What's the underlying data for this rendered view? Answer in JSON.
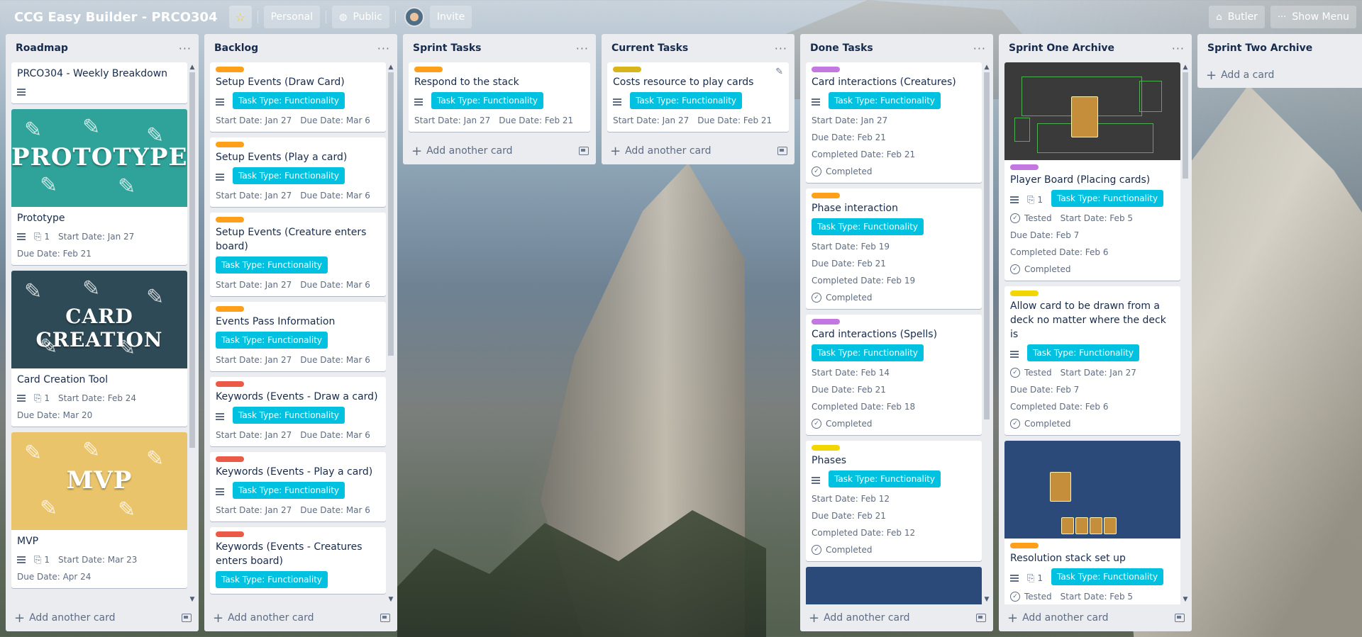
{
  "header": {
    "board_title": "CCG Easy Builder - PRCO304",
    "personal_label": "Personal",
    "public_label": "Public",
    "invite_label": "Invite",
    "butler_label": "Butler",
    "show_menu_label": "Show Menu"
  },
  "common": {
    "add_another_card": "Add another card",
    "add_a_card": "Add a card",
    "task_type": "Task Type: Functionality",
    "completed": "Completed",
    "tested": "Tested",
    "list_menu": "···"
  },
  "lists": {
    "roadmap": {
      "title": "Roadmap",
      "cards": [
        {
          "title": "PRCO304 - Weekly Breakdown"
        },
        {
          "cover": "PROTOTYPE",
          "title": "Prototype",
          "attachments": "1",
          "start": "Start Date: Jan 27",
          "due": "Due Date: Feb 21"
        },
        {
          "cover": "CARD CREATION",
          "title": "Card Creation Tool",
          "attachments": "1",
          "start": "Start Date: Feb 24",
          "due": "Due Date: Mar 20"
        },
        {
          "cover": "MVP",
          "title": "MVP",
          "attachments": "1",
          "start": "Start Date: Mar 23",
          "due": "Due Date: Apr 24"
        }
      ]
    },
    "backlog": {
      "title": "Backlog",
      "cards": [
        {
          "title": "Setup Events (Draw Card)",
          "start": "Start Date: Jan 27",
          "due": "Due Date: Mar 6"
        },
        {
          "title": "Setup Events (Play a card)",
          "start": "Start Date: Jan 27",
          "due": "Due Date: Mar 6"
        },
        {
          "title": "Setup Events (Creature enters board)",
          "start": "Start Date: Jan 27",
          "due": "Due Date: Mar 6"
        },
        {
          "title": "Events Pass Information",
          "start": "Start Date: Jan 27",
          "due": "Due Date: Mar 6"
        },
        {
          "title": "Keywords (Events - Draw a card)",
          "start": "Start Date: Jan 27",
          "due": "Due Date: Mar 6"
        },
        {
          "title": "Keywords (Events - Play a card)",
          "start": "Start Date: Jan 27",
          "due": "Due Date: Mar 6"
        },
        {
          "title": "Keywords (Events - Creatures enters board)"
        }
      ]
    },
    "sprint": {
      "title": "Sprint Tasks",
      "cards": [
        {
          "title": "Respond to the stack",
          "start": "Start Date: Jan 27",
          "due": "Due Date: Feb 21"
        }
      ]
    },
    "current": {
      "title": "Current Tasks",
      "cards": [
        {
          "title": "Costs resource to play cards",
          "start": "Start Date: Jan 27",
          "due": "Due Date: Feb 21"
        }
      ]
    },
    "done": {
      "title": "Done Tasks",
      "cards": [
        {
          "title": "Card interactions (Creatures)",
          "start": "Start Date: Jan 27",
          "due": "Due Date: Feb 21",
          "completed_date": "Completed Date: Feb 21"
        },
        {
          "title": "Phase interaction",
          "start": "Start Date: Feb 19",
          "due": "Due Date: Feb 21",
          "completed_date": "Completed Date: Feb 19"
        },
        {
          "title": "Card interactions (Spells)",
          "start": "Start Date: Feb 14",
          "due": "Due Date: Feb 21",
          "completed_date": "Completed Date: Feb 18"
        },
        {
          "title": "Phases",
          "start": "Start Date: Feb 12",
          "due": "Due Date: Feb 21",
          "completed_date": "Completed Date: Feb 12"
        }
      ]
    },
    "sprint_one": {
      "title": "Sprint One Archive",
      "cards": [
        {
          "title": "Player Board (Placing cards)",
          "attachments": "1",
          "start": "Start Date: Feb 5",
          "due": "Due Date: Feb 7",
          "completed_date": "Completed Date: Feb 6"
        },
        {
          "title": "Allow card to be drawn from a deck no matter where the deck is",
          "start": "Start Date: Jan 27",
          "due": "Due Date: Feb 7",
          "completed_date": "Completed Date: Feb 6"
        },
        {
          "title": "Resolution stack set up",
          "attachments": "1",
          "start": "Start Date: Feb 5"
        }
      ]
    },
    "sprint_two": {
      "title": "Sprint Two Archive"
    }
  },
  "colors": {
    "label_orange": "#ff9f1a",
    "label_red": "#eb5a46",
    "label_purple": "#c377e0",
    "label_yellow": "#f2d600",
    "label_yellow_dark": "#d9b51c",
    "task_chip": "#00c2e0",
    "cover_teal": "#2fa39a",
    "cover_dark": "#2e4a56",
    "cover_yellow": "#e9c46a",
    "cover_navy": "#2b4a7a"
  }
}
